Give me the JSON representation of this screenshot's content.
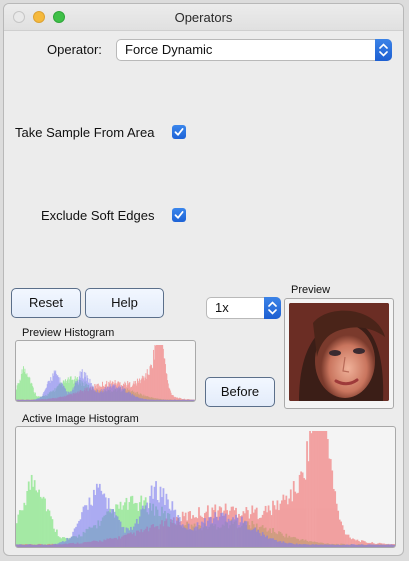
{
  "window": {
    "title": "Operators"
  },
  "operator": {
    "label": "Operator:",
    "value": "Force Dynamic"
  },
  "options": {
    "take_sample": {
      "label": "Take Sample From Area",
      "checked": true
    },
    "exclude_soft_edges": {
      "label": "Exclude Soft Edges",
      "checked": true
    }
  },
  "buttons": {
    "reset": "Reset",
    "help": "Help",
    "before": "Before"
  },
  "zoom": {
    "value": "1x"
  },
  "preview": {
    "label": "Preview"
  },
  "histograms": {
    "preview_label": "Preview Histogram",
    "active_label": "Active Image Histogram"
  },
  "colors": {
    "checkbox": "#1f64d8",
    "stepper": "#2b70e0",
    "hist_red": "#f06a6a",
    "hist_green": "#6fe26f",
    "hist_blue": "#7b7bf0"
  }
}
